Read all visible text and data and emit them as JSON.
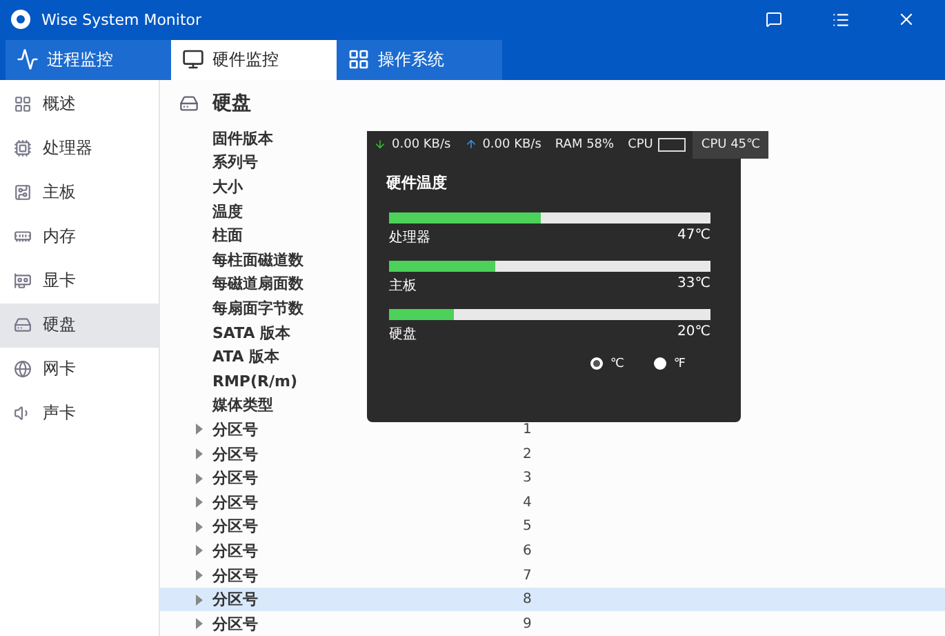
{
  "window": {
    "title": "Wise System Monitor"
  },
  "tabs": [
    {
      "label": "进程监控",
      "selected": false,
      "kind": "pulse"
    },
    {
      "label": "硬件监控",
      "selected": true,
      "kind": "monitor"
    },
    {
      "label": "操作系统",
      "selected": false,
      "kind": "windows"
    }
  ],
  "sidebar": {
    "items": [
      {
        "label": "概述",
        "selected": false,
        "kind": "grid"
      },
      {
        "label": "处理器",
        "selected": false,
        "kind": "cpu"
      },
      {
        "label": "主板",
        "selected": false,
        "kind": "board"
      },
      {
        "label": "内存",
        "selected": false,
        "kind": "memory"
      },
      {
        "label": "显卡",
        "selected": false,
        "kind": "gpu"
      },
      {
        "label": "硬盘",
        "selected": true,
        "kind": "disk"
      },
      {
        "label": "网卡",
        "selected": false,
        "kind": "globe"
      },
      {
        "label": "声卡",
        "selected": false,
        "kind": "speaker"
      }
    ]
  },
  "section": {
    "title": "硬盘"
  },
  "properties": [
    {
      "label": "固件版本"
    },
    {
      "label": "系列号"
    },
    {
      "label": "大小"
    },
    {
      "label": "温度"
    },
    {
      "label": "柱面"
    },
    {
      "label": "每柱面磁道数"
    },
    {
      "label": "每磁道扇面数"
    },
    {
      "label": "每扇面字节数"
    },
    {
      "label": "SATA 版本"
    },
    {
      "label": "ATA 版本"
    },
    {
      "label": "RMP(R/m)"
    },
    {
      "label": "媒体类型"
    }
  ],
  "partitions": [
    {
      "label": "分区号",
      "value": "1",
      "selected": false,
      "expanded": false
    },
    {
      "label": "分区号",
      "value": "2",
      "selected": false,
      "expanded": false
    },
    {
      "label": "分区号",
      "value": "3",
      "selected": false,
      "expanded": false
    },
    {
      "label": "分区号",
      "value": "4",
      "selected": false,
      "expanded": false
    },
    {
      "label": "分区号",
      "value": "5",
      "selected": false,
      "expanded": false
    },
    {
      "label": "分区号",
      "value": "6",
      "selected": false,
      "expanded": false
    },
    {
      "label": "分区号",
      "value": "7",
      "selected": false,
      "expanded": false
    },
    {
      "label": "分区号",
      "value": "8",
      "selected": true,
      "expanded": false
    },
    {
      "label": "分区号",
      "value": "9",
      "selected": false,
      "expanded": false
    }
  ],
  "monitor_bar": {
    "download": "0.00 KB/s",
    "upload": "0.00 KB/s",
    "ram": "RAM 58%",
    "cpu_label": "CPU",
    "cpu_temp": "CPU 45℃"
  },
  "temperature_panel": {
    "title": "硬件温度",
    "sensors": [
      {
        "name": "处理器",
        "level": 0.47,
        "reading": "47℃"
      },
      {
        "name": "主板",
        "level": 0.33,
        "reading": "33℃"
      },
      {
        "name": "硬盘",
        "level": 0.2,
        "reading": "20℃"
      }
    ],
    "units": [
      {
        "label": "℃",
        "selected": true
      },
      {
        "label": "℉",
        "selected": false
      }
    ]
  }
}
